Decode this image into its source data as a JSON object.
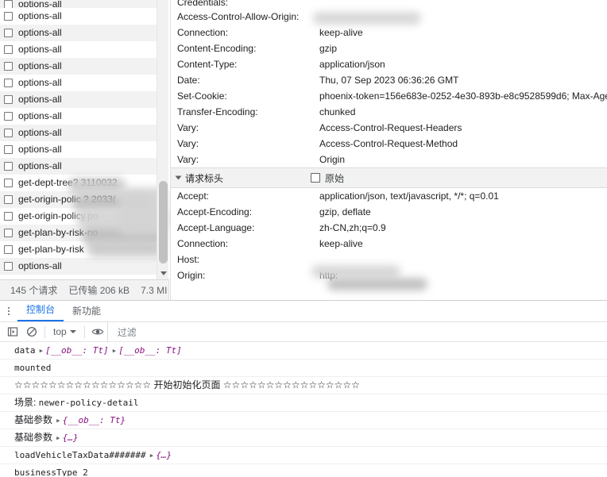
{
  "network": {
    "requests": [
      {
        "name": "options-all",
        "partial": true
      },
      {
        "name": "options-all"
      },
      {
        "name": "options-all"
      },
      {
        "name": "options-all"
      },
      {
        "name": "options-all"
      },
      {
        "name": "options-all"
      },
      {
        "name": "options-all"
      },
      {
        "name": "options-all"
      },
      {
        "name": "options-all"
      },
      {
        "name": "options-all"
      },
      {
        "name": "options-all"
      },
      {
        "name": "get-dept-tree?                 3110032"
      },
      {
        "name": "get-origin-polic  ?            2033("
      },
      {
        "name": "get-origin-policy.po"
      },
      {
        "name": "get-plan-by-risk-no"
      },
      {
        "name": "get-plan-by-risk"
      },
      {
        "name": "options-all"
      }
    ],
    "status": {
      "requests": "145 个请求",
      "transferred": "已传输 206 kB",
      "resources": "7.3 MI"
    },
    "scrollbar": {
      "name": "list-scrollbar"
    }
  },
  "headers": {
    "response_rows": [
      {
        "key": "Credentials:",
        "value": "",
        "redacted": false,
        "clipped": true
      },
      {
        "key": "Access-Control-Allow-Origin:",
        "value": "",
        "redacted": true
      },
      {
        "key": "Connection:",
        "value": "keep-alive"
      },
      {
        "key": "Content-Encoding:",
        "value": "gzip"
      },
      {
        "key": "Content-Type:",
        "value": "application/json"
      },
      {
        "key": "Date:",
        "value": "Thu, 07 Sep 2023 06:36:26 GMT"
      },
      {
        "key": "Set-Cookie:",
        "value": "phoenix-token=156e683e-0252-4e30-893b-e8c9528599d6; Max-Age"
      },
      {
        "key": "Transfer-Encoding:",
        "value": "chunked"
      },
      {
        "key": "Vary:",
        "value": "Access-Control-Request-Headers"
      },
      {
        "key": "Vary:",
        "value": "Access-Control-Request-Method"
      },
      {
        "key": "Vary:",
        "value": "Origin"
      }
    ],
    "request_section": {
      "title": "请求标头",
      "raw_label": "原始",
      "raw_checked": false
    },
    "request_rows": [
      {
        "key": "Accept:",
        "value": "application/json, text/javascript, */*; q=0.01"
      },
      {
        "key": "Accept-Encoding:",
        "value": "gzip, deflate"
      },
      {
        "key": "Accept-Language:",
        "value": "zh-CN,zh;q=0.9"
      },
      {
        "key": "Connection:",
        "value": "keep-alive"
      },
      {
        "key": "Host:",
        "value": "",
        "redacted": true
      },
      {
        "key": "Origin:",
        "value": "http:",
        "redacted": true
      }
    ]
  },
  "console": {
    "tabs": [
      {
        "label": "控制台",
        "active": true
      },
      {
        "label": "新功能",
        "active": false
      }
    ],
    "toolbar": {
      "context": "top",
      "filter_placeholder": "过滤"
    },
    "log_lines": [
      {
        "text": "data",
        "obj1": "[__ob__: Tt]",
        "obj2": "[__ob__: Tt]",
        "kind": "data-obj"
      },
      {
        "text": "mounted",
        "kind": "plain"
      },
      {
        "stars_left": "☆☆☆☆☆☆☆☆☆☆☆☆☆☆☆☆",
        "mid": "开始初始化页面",
        "stars_right": "☆☆☆☆☆☆☆☆☆☆☆☆☆☆☆☆",
        "kind": "stars"
      },
      {
        "label": "场景:",
        "value": "newer-policy-detail",
        "kind": "labeled"
      },
      {
        "label": "基础参数",
        "obj1": "{__ob__: Tt}",
        "kind": "zh-obj"
      },
      {
        "label": "基础参数",
        "obj1": "{…}",
        "kind": "zh-obj"
      },
      {
        "label": "loadVehicleTaxData#######",
        "obj1": "{…}",
        "kind": "mono-obj"
      },
      {
        "text": "businessType 2",
        "kind": "plain"
      }
    ]
  },
  "colors": {
    "accent": "#1a73e8",
    "object": "#881280",
    "stripe": "#f2f2f2",
    "border": "#e0e0e0",
    "muted": "#5f6368"
  }
}
